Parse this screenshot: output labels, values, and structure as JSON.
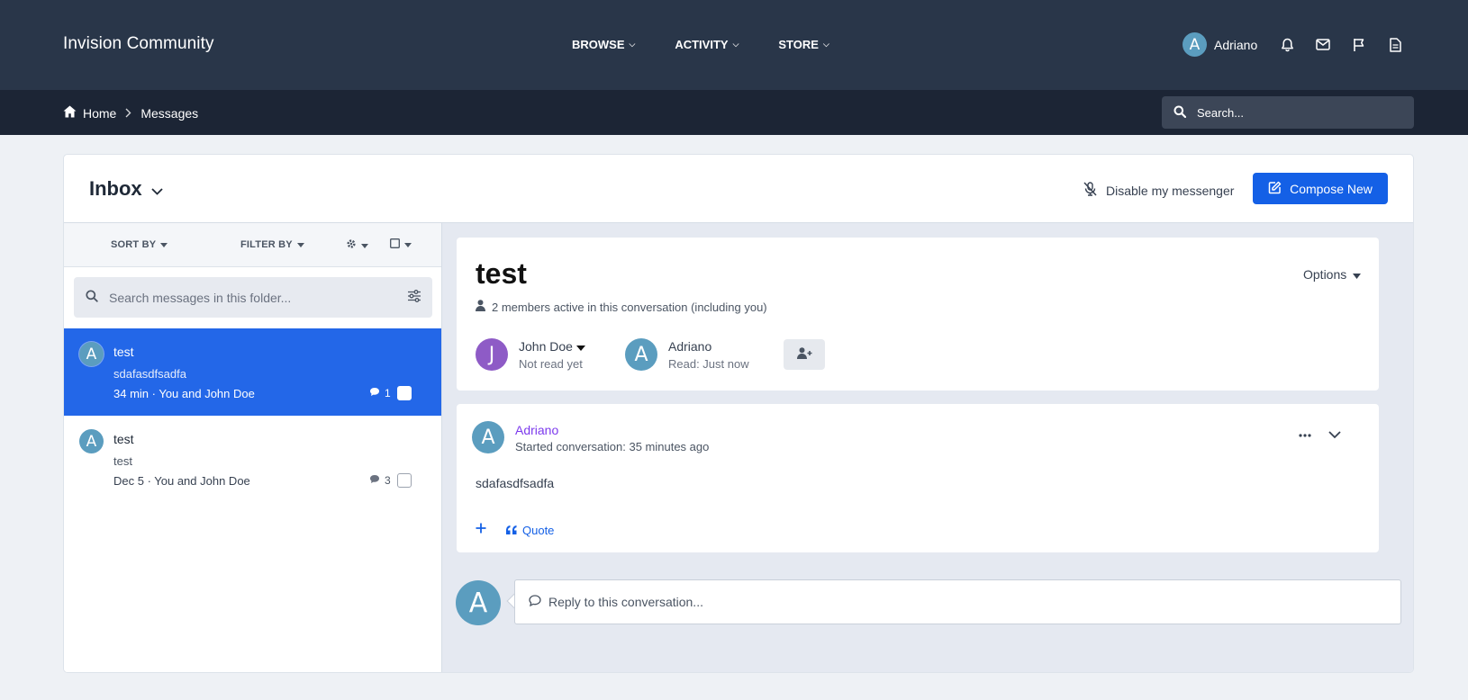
{
  "header": {
    "site_title": "Invision Community",
    "nav": [
      {
        "label": "BROWSE"
      },
      {
        "label": "ACTIVITY"
      },
      {
        "label": "STORE"
      }
    ],
    "user": {
      "initial": "A",
      "name": "Adriano"
    },
    "icons": [
      "bell-icon",
      "envelope-icon",
      "flag-icon",
      "document-icon"
    ]
  },
  "subheader": {
    "breadcrumb": {
      "home": "Home",
      "current": "Messages"
    },
    "search_placeholder": "Search..."
  },
  "messenger": {
    "folder_title": "Inbox",
    "disable_label": "Disable my messenger",
    "compose_label": "Compose New",
    "filters": {
      "sort_label": "SORT BY",
      "filter_label": "FILTER BY"
    },
    "folder_search_placeholder": "Search messages in this folder...",
    "conversations": [
      {
        "initial": "A",
        "title": "test",
        "snippet": "sdafasdfsadfa",
        "meta": "34 min · You and John Doe",
        "count": "1",
        "active": true
      },
      {
        "initial": "A",
        "title": "test",
        "snippet": "test",
        "meta": "Dec 5 · You and John Doe",
        "count": "3",
        "active": false
      }
    ]
  },
  "conversation": {
    "title": "test",
    "members_text": "2 members active in this conversation (including you)",
    "options_label": "Options",
    "participants": [
      {
        "initial": "J",
        "name": "John Doe",
        "status": "Not read yet",
        "color": "#8e5bc6"
      },
      {
        "initial": "A",
        "name": "Adriano",
        "status": "Read: Just now",
        "color": "#5b9dbf"
      }
    ]
  },
  "post": {
    "initial": "A",
    "author": "Adriano",
    "date": "Started conversation: 35 minutes ago",
    "body": "sdafasdfsadfa",
    "quote_label": "Quote"
  },
  "reply": {
    "initial": "A",
    "placeholder": "Reply to this conversation..."
  },
  "colors": {
    "header_bg": "#293649",
    "subheader_bg": "#1c2535",
    "accent": "#1460e6",
    "active_row": "#2367e8",
    "avatar": "#5b9dbf",
    "author_link": "#7c3aed"
  }
}
